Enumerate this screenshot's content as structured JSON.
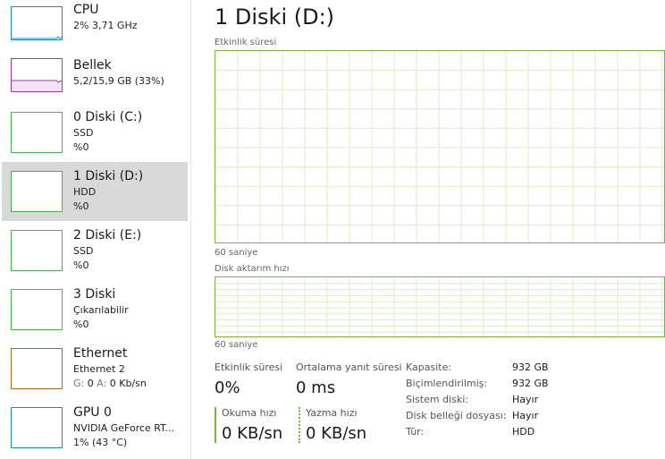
{
  "sidebar": {
    "items": [
      {
        "title": "CPU",
        "sub1": "2% 3,71 GHz",
        "sub2": "",
        "color": "#1a8fb5"
      },
      {
        "title": "Bellek",
        "sub1": "5,2/15,9 GB (33%)",
        "sub2": "",
        "color": "#a13bb2"
      },
      {
        "title": "0 Diski (C:)",
        "sub1": "SSD",
        "sub2": "%0",
        "color": "#4caf50"
      },
      {
        "title": "1 Diski (D:)",
        "sub1": "HDD",
        "sub2": "%0",
        "color": "#4caf50"
      },
      {
        "title": "2 Diski (E:)",
        "sub1": "SSD",
        "sub2": "%0",
        "color": "#4caf50"
      },
      {
        "title": "3 Diski",
        "sub1": "Çıkarılabilir",
        "sub2": "%0",
        "color": "#4caf50"
      },
      {
        "title": "Ethernet",
        "sub1": "Ethernet 2",
        "sub2_parts": [
          "G:",
          " 0 ",
          "A:",
          " 0 Kb/sn"
        ],
        "color": "#a8651e"
      },
      {
        "title": "GPU 0",
        "sub1": "NVIDIA GeForce RT...",
        "sub2": "1% (43 °C)",
        "color": "#1a8fb5"
      }
    ]
  },
  "main": {
    "title": "1 Diski (D:)",
    "graph1_label": "Etkinlik süresi",
    "graph1_footer": "60 saniye",
    "graph2_label": "Disk aktarım hızı",
    "graph2_footer": "60 saniye",
    "stats": {
      "active_label": "Etkinlik süresi",
      "active_value": "0%",
      "response_label": "Ortalama yanıt süresi",
      "response_value": "0 ms",
      "read_label": "Okuma hızı",
      "read_value": "0 KB/sn",
      "write_label": "Yazma hızı",
      "write_value": "0 KB/sn"
    },
    "properties": [
      {
        "key": "Kapasite:",
        "value": "932 GB"
      },
      {
        "key": "Biçimlendirilmiş:",
        "value": "932 GB"
      },
      {
        "key": "Sistem diski:",
        "value": "Hayır"
      },
      {
        "key": "Disk belleği dosyası:",
        "value": "Hayır"
      },
      {
        "key": "Tür:",
        "value": "HDD"
      }
    ]
  },
  "colors": {
    "accent_disk": "#7cb342",
    "selected_bg": "#d9d9d9",
    "grid": "#dcedc8"
  }
}
